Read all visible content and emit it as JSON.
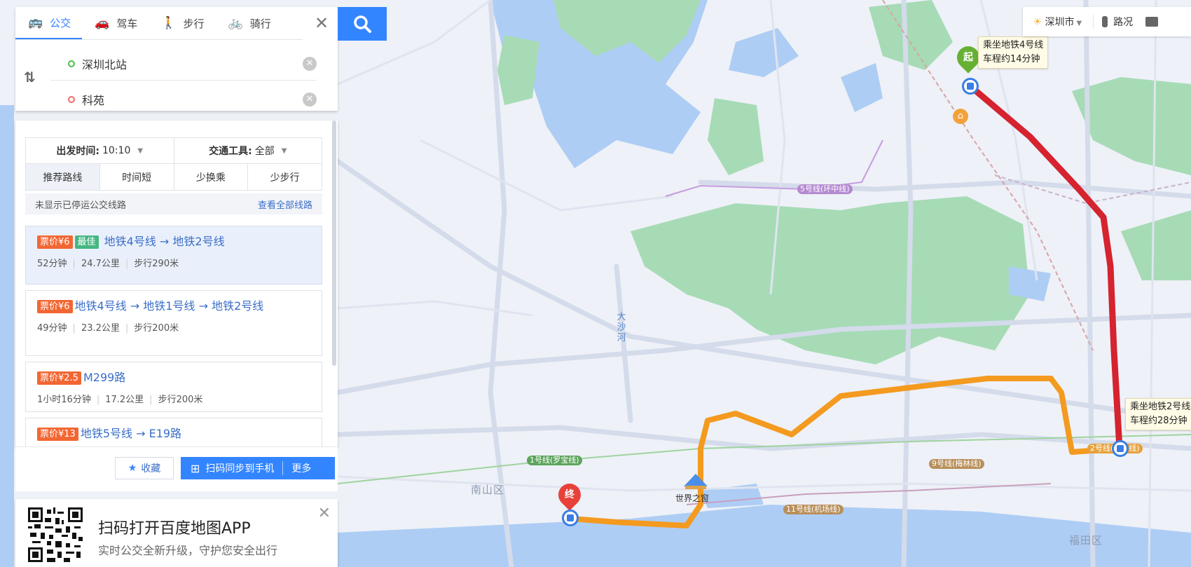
{
  "mode_tabs": [
    {
      "label": "公交",
      "icon": "bus-icon",
      "active": true
    },
    {
      "label": "驾车",
      "icon": "car-icon",
      "active": false
    },
    {
      "label": "步行",
      "icon": "walk-icon",
      "active": false
    },
    {
      "label": "骑行",
      "icon": "bike-icon",
      "active": false
    }
  ],
  "search": {
    "start": "深圳北站",
    "end": "科苑"
  },
  "filters": {
    "depart_label": "出发时间:",
    "depart_value": "10:10",
    "vehicle_label": "交通工具:",
    "vehicle_value": "全部",
    "sort_tabs": [
      "推荐路线",
      "时间短",
      "少换乘",
      "少步行"
    ]
  },
  "notice": {
    "text": "未显示已停运公交线路",
    "link": "查看全部线路"
  },
  "routes": [
    {
      "price": "票价¥6",
      "badge": "最佳",
      "title": "地铁4号线 → 地铁2号线",
      "duration": "52分钟",
      "distance": "24.7公里",
      "walk": "步行290米"
    },
    {
      "price": "票价¥6",
      "badge": "",
      "title": "地铁4号线 → 地铁1号线 → 地铁2号线",
      "duration": "49分钟",
      "distance": "23.2公里",
      "walk": "步行200米"
    },
    {
      "price": "票价¥2.5",
      "badge": "",
      "title": "M299路",
      "duration": "1小时16分钟",
      "distance": "17.2公里",
      "walk": "步行200米"
    },
    {
      "price": "票价¥13",
      "badge": "",
      "title": "地铁5号线 → E19路",
      "duration": "",
      "distance": "",
      "walk": ""
    }
  ],
  "actions": {
    "favorite": "收藏",
    "sync": "扫码同步到手机",
    "more": "更多"
  },
  "promo": {
    "title": "扫码打开百度地图APP",
    "subtitle": "实时公交全新升级，守护您安全出行"
  },
  "top_right": {
    "city": "深圳市",
    "traffic": "路况"
  },
  "map": {
    "start_pin": "起",
    "end_pin": "终",
    "callout_start_line1": "乘坐地铁4号线",
    "callout_start_line2": "车程约14分钟",
    "callout_mid_line1": "乘坐地铁2号线",
    "callout_mid_line2": "车程约28分钟",
    "line_labels": {
      "line5": "5号线(环中线)",
      "line1": "1号线(罗宝线)",
      "line9": "9号线(梅林线)",
      "line11": "11号线(机场线)",
      "line2": "2号线(蛇口线)"
    },
    "landmark": "世界之窗",
    "districts": {
      "nanshan": "南山区",
      "futian": "福田区"
    },
    "river": "大沙河",
    "colors": {
      "metro4": "#d5232f",
      "metro2": "#f39a1f",
      "water": "#aecdf5",
      "park": "#a6dbb6"
    }
  }
}
